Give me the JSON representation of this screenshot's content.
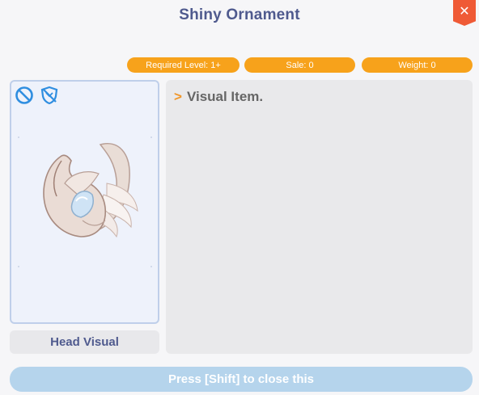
{
  "window": {
    "title": "Shiny Ornament",
    "close_label": "✕"
  },
  "stats": {
    "required_level": "Required Level: 1+",
    "sale": "Sale: 0",
    "weight": "Weight: 0"
  },
  "item": {
    "icons": [
      "no-trade-icon",
      "no-storage-shield-icon"
    ],
    "art": "shiny-ornament-wing-headgear",
    "slot": "Head Visual"
  },
  "description": {
    "lines": [
      "Visual Item."
    ]
  },
  "footer": {
    "close_hint": "Press [Shift] to close this"
  },
  "colors": {
    "title": "#4f5a8e",
    "pill": "#f7a21b",
    "close": "#ef5a36",
    "card_border": "#bfcfea",
    "footer_button": "#b5d4ec",
    "desc_arrow": "#f0962a"
  }
}
